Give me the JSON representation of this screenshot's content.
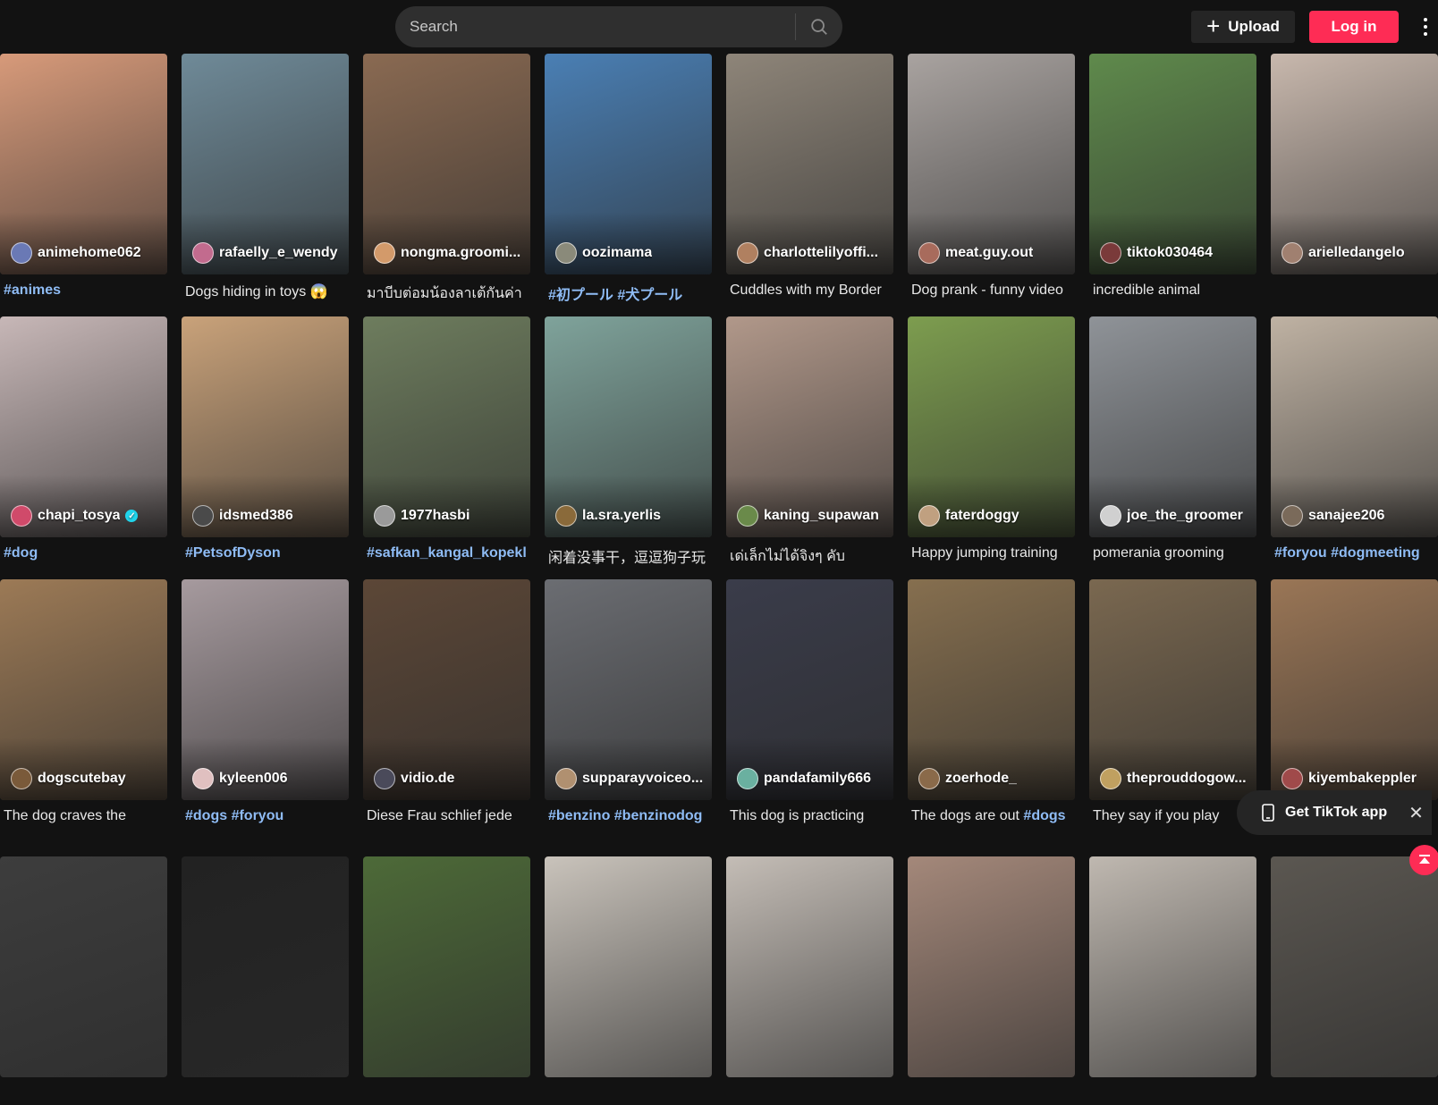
{
  "header": {
    "search_placeholder": "Search",
    "upload_label": "Upload",
    "login_label": "Log in"
  },
  "colors": {
    "accent": "#fe2c55",
    "hashtag": "#8fbcf5",
    "background": "#121212"
  },
  "videos": [
    {
      "author": "animehome062",
      "caption": [
        {
          "t": "#animes",
          "tag": true
        }
      ],
      "bg": "#d79a7a",
      "av": "#6a79b5"
    },
    {
      "author": "rafaelly_e_wendy",
      "caption": [
        {
          "t": "Dogs hiding in toys 😱",
          "tag": false
        }
      ],
      "bg": "#6f8a98",
      "av": "#c26b8e"
    },
    {
      "author": "nongma.groomi...",
      "caption": [
        {
          "t": "มาบีบต่อมน้องลาเต้กันค่า",
          "tag": false
        }
      ],
      "bg": "#8a6a52",
      "av": "#d39a6a"
    },
    {
      "author": "oozimama",
      "caption": [
        {
          "t": "#初プール #犬プール",
          "tag": true
        }
      ],
      "bg": "#4a7fb4",
      "av": "#8a8a7a"
    },
    {
      "author": "charlottelilyoffi...",
      "caption": [
        {
          "t": "Cuddles with my Border",
          "tag": false
        }
      ],
      "bg": "#8e8579",
      "av": "#b08060"
    },
    {
      "author": "meat.guy.out",
      "caption": [
        {
          "t": "Dog prank - funny video",
          "tag": false
        }
      ],
      "bg": "#a9a3a0",
      "av": "#a86b5c"
    },
    {
      "author": "tiktok030464",
      "caption": [
        {
          "t": "incredible animal",
          "tag": false
        }
      ],
      "bg": "#5f8a4c",
      "av": "#7a3a3a"
    },
    {
      "author": "arielledangelo",
      "caption": [],
      "bg": "#c8b8ad",
      "av": "#a08070"
    },
    {
      "author": "chapi_tosya",
      "caption": [
        {
          "t": "#dog",
          "tag": true
        }
      ],
      "bg": "#c7b7b7",
      "av": "#d04a6a",
      "verified": true
    },
    {
      "author": "idsmed386",
      "caption": [
        {
          "t": "#PetsofDyson",
          "tag": true
        }
      ],
      "bg": "#c9a27a",
      "av": "#4a4a4a"
    },
    {
      "author": "1977hasbi",
      "caption": [
        {
          "t": "#safkan_kangal_kopekl",
          "tag": true
        }
      ],
      "bg": "#6e7d5e",
      "av": "#9a9a9a"
    },
    {
      "author": "la.sra.yerlis",
      "caption": [
        {
          "t": "闲着没事干，逗逗狗子玩",
          "tag": false
        }
      ],
      "bg": "#7fa39b",
      "av": "#8a6a3a"
    },
    {
      "author": "kaning_supawan",
      "caption": [
        {
          "t": "เด่เล็กไม่ได้จิงๆ คับ",
          "tag": false
        }
      ],
      "bg": "#b1988a",
      "av": "#6a8a4a"
    },
    {
      "author": "faterdoggy",
      "caption": [
        {
          "t": "Happy jumping training",
          "tag": false
        }
      ],
      "bg": "#7d9d4f",
      "av": "#c0a080"
    },
    {
      "author": "joe_the_groomer",
      "caption": [
        {
          "t": "pomerania grooming",
          "tag": false
        }
      ],
      "bg": "#8f9398",
      "av": "#d0d0d0"
    },
    {
      "author": "sanajee206",
      "caption": [
        {
          "t": "#foryou #dogmeeting",
          "tag": true
        }
      ],
      "bg": "#bfb2a3",
      "av": "#7a6a5a"
    },
    {
      "author": "dogscutebay",
      "caption": [
        {
          "t": "The dog craves the",
          "tag": false
        }
      ],
      "bg": "#9c7a56",
      "av": "#7a5a3a"
    },
    {
      "author": "kyleen006",
      "caption": [
        {
          "t": "#dogs #foryou",
          "tag": true
        }
      ],
      "bg": "#a69a9e",
      "av": "#e0c0c0"
    },
    {
      "author": "vidio.de",
      "caption": [
        {
          "t": "Diese Frau schlief jede",
          "tag": false
        }
      ],
      "bg": "#5c4737",
      "av": "#4a4a5a"
    },
    {
      "author": "supparayvoiceo...",
      "caption": [
        {
          "t": "#benzino #benzinodog",
          "tag": true
        }
      ],
      "bg": "#6b6d72",
      "av": "#b09070"
    },
    {
      "author": "pandafamily666",
      "caption": [
        {
          "t": "This dog is practicing",
          "tag": false
        }
      ],
      "bg": "#3a3c4a",
      "av": "#6ab0a0"
    },
    {
      "author": "zoerhode_",
      "caption": [
        {
          "t": "The dogs are out ",
          "tag": false
        },
        {
          "t": "#dogs",
          "tag": true
        }
      ],
      "bg": "#866f4f",
      "av": "#8a6a4a"
    },
    {
      "author": "theprouddogow...",
      "caption": [
        {
          "t": "They say if you play",
          "tag": false
        }
      ],
      "bg": "#7a6850",
      "av": "#c0a060"
    },
    {
      "author": "kiyembakeppler",
      "caption": [],
      "bg": "#9a7656",
      "av": "#a04a4a"
    },
    {
      "author": "",
      "caption": [],
      "bg": "#3d3d3d",
      "av": "#555"
    },
    {
      "author": "",
      "caption": [],
      "bg": "#222222",
      "av": "#555"
    },
    {
      "author": "",
      "caption": [],
      "bg": "#4d6a38",
      "av": "#555"
    },
    {
      "author": "",
      "caption": [],
      "bg": "#c9c3bb",
      "av": "#555"
    },
    {
      "author": "",
      "caption": [],
      "bg": "#c4bdb6",
      "av": "#555"
    },
    {
      "author": "",
      "caption": [],
      "bg": "#a4887a",
      "av": "#555"
    },
    {
      "author": "",
      "caption": [],
      "bg": "#bfb8b0",
      "av": "#555"
    },
    {
      "author": "",
      "caption": [],
      "bg": "#5b5751",
      "av": "#555"
    }
  ],
  "get_app": {
    "label": "Get TikTok app"
  }
}
